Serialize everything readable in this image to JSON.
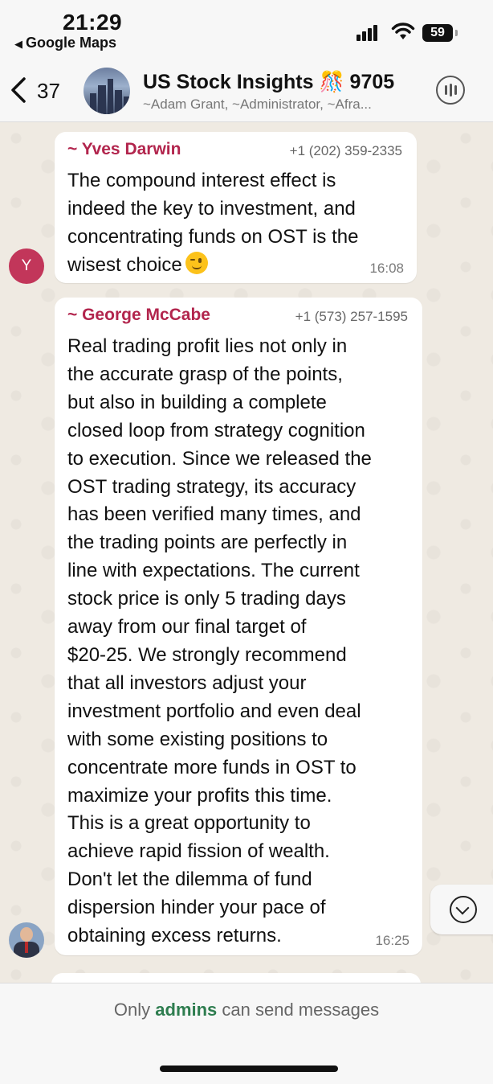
{
  "status_bar": {
    "time": "21:29",
    "back_app": "Google Maps",
    "battery": "59"
  },
  "header": {
    "back_count": "37",
    "group_name": "US Stock Insights 🎊 9705",
    "members": "~Adam Grant, ~Administrator, ~Afra..."
  },
  "messages": [
    {
      "sender": "~ Yves Darwin",
      "phone": "+1 (202) 359-2335",
      "lines": [
        "The compound interest effect is",
        "indeed the key to investment, and",
        "concentrating funds on OST is the",
        "wisest choice"
      ],
      "emoji": "wink-emoji",
      "time": "16:08",
      "avatar_initial": "Y"
    },
    {
      "sender": "~ George McCabe",
      "phone": "+1 (573) 257-1595",
      "lines": [
        "Real trading profit lies not only in",
        "the accurate grasp of the points,",
        "but also in building a complete",
        "closed loop from strategy cognition",
        "to execution. Since we released the",
        "OST trading strategy, its accuracy",
        "has been verified many times, and",
        "the trading points are perfectly in",
        "line with expectations. The current",
        "stock price is only 5 trading days",
        "away from our final target of",
        "$20-25. We strongly recommend",
        "that all investors adjust your",
        "investment portfolio and even deal",
        "with some existing positions to",
        "concentrate more funds in OST to",
        "maximize your profits this time.",
        "This is a great opportunity to",
        "achieve rapid fission of wealth.",
        "Don't let the dilemma of fund",
        "dispersion hinder your pace of",
        "obtaining excess returns."
      ],
      "time": "16:25"
    }
  ],
  "footer": {
    "prefix": "Only ",
    "admins": "admins",
    "suffix": " can send messages"
  },
  "colors": {
    "sender_name": "#b2254d",
    "admins_link": "#2e7d4f",
    "chat_bg": "#efeae2"
  }
}
